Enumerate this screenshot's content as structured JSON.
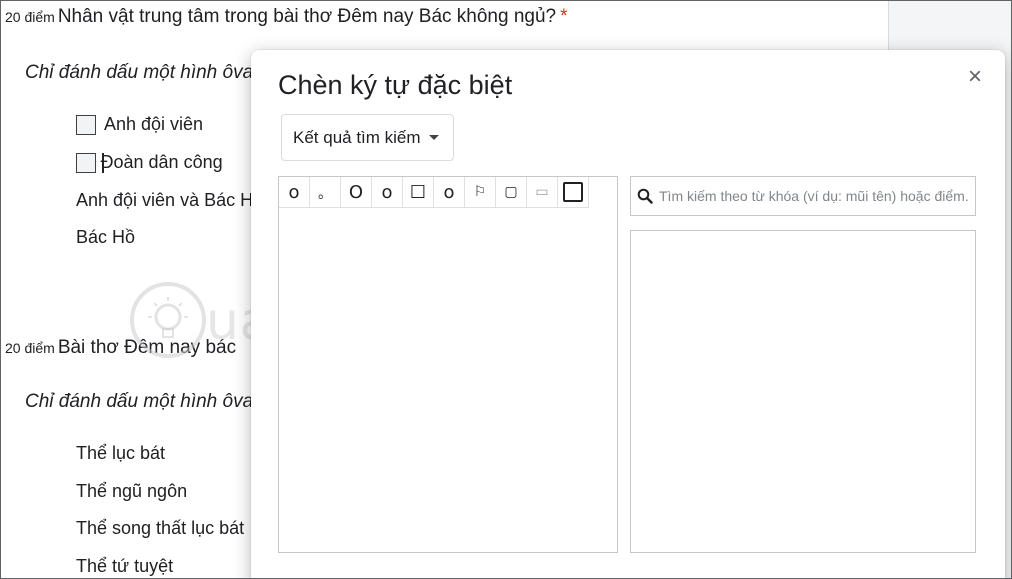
{
  "questions": [
    {
      "points": "20 điểm",
      "title": "Nhân vật trung tâm trong bài thơ Đêm nay Bác không ngủ?",
      "required_mark": "*",
      "instruction": "Chỉ đánh dấu một hình ôva",
      "options": [
        "Anh đội viên",
        "Đoàn dân công",
        "Anh đội viên và Bác H",
        "Bác Hồ"
      ]
    },
    {
      "points": "20 điểm",
      "title": "Bài thơ Đêm nay bác",
      "instruction": "Chỉ đánh dấu một hình ôva",
      "options": [
        "Thể lục bát",
        "Thể ngũ ngôn",
        "Thể song thất lục bát",
        "Thể tứ tuyệt"
      ]
    }
  ],
  "watermark": {
    "text": "uantrimang"
  },
  "dialog": {
    "title": "Chèn ký tự đặc biệt",
    "close_label": "×",
    "dropdown": {
      "selected": "Kết quả tìm kiếm"
    },
    "characters": [
      "o",
      "。",
      "O",
      "o",
      "☐",
      "o",
      "⚐",
      "▢",
      "▭",
      "▢"
    ],
    "search": {
      "placeholder": "Tìm kiếm theo từ khóa (ví dụ: mũi tên) hoặc điểm...",
      "value": ""
    }
  },
  "colors": {
    "required": "#d93025",
    "text": "#202124",
    "border": "#c6c6c6",
    "side_panel": "#f4f5f7"
  }
}
